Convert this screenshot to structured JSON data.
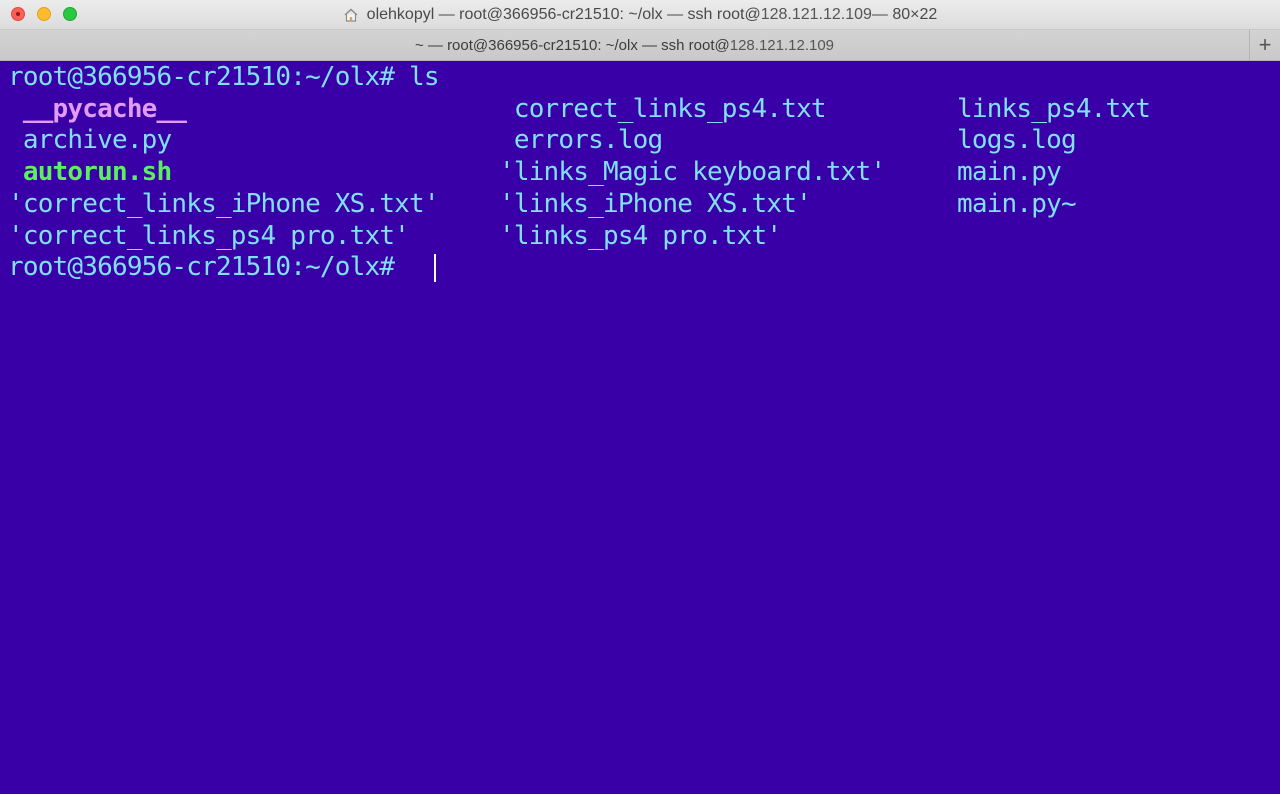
{
  "window": {
    "title_main": "olehkopyl — root@366956-cr21510: ~/olx — ssh root@",
    "title_ip": "128.121.12.109",
    "title_size": " — 80×22",
    "tab_main": "~ — root@366956-cr21510: ~/olx — ssh root@",
    "tab_ip": "128.121.12.109",
    "new_tab_label": "+"
  },
  "terminal": {
    "command_line": "root@366956-cr21510:~/olx# ls",
    "prompt_line": "root@366956-cr21510:~/olx# ",
    "listing": {
      "col1": [
        {
          "text": " __pycache__",
          "kind": "dir"
        },
        {
          "text": " archive.py",
          "kind": "file"
        },
        {
          "text": " autorun.sh",
          "kind": "exec"
        },
        {
          "text": "'correct_links_iPhone XS.txt'",
          "kind": "file"
        },
        {
          "text": "'correct_links_ps4 pro.txt'",
          "kind": "file"
        }
      ],
      "col2": [
        {
          "text": " correct_links_ps4.txt",
          "kind": "file"
        },
        {
          "text": " errors.log",
          "kind": "file"
        },
        {
          "text": "'links_Magic keyboard.txt'",
          "kind": "file"
        },
        {
          "text": "'links_iPhone XS.txt'",
          "kind": "file"
        },
        {
          "text": "'links_ps4 pro.txt'",
          "kind": "file"
        }
      ],
      "col3": [
        {
          "text": "links_ps4.txt",
          "kind": "file"
        },
        {
          "text": "logs.log",
          "kind": "file"
        },
        {
          "text": "main.py",
          "kind": "file"
        },
        {
          "text": "main.py~",
          "kind": "file"
        }
      ]
    }
  },
  "colors": {
    "background": "#3a00a8",
    "text": "#7fe0f6",
    "directory": "#e29cf5",
    "executable": "#5bf060"
  },
  "icons": {
    "title_icon": "home-icon"
  }
}
